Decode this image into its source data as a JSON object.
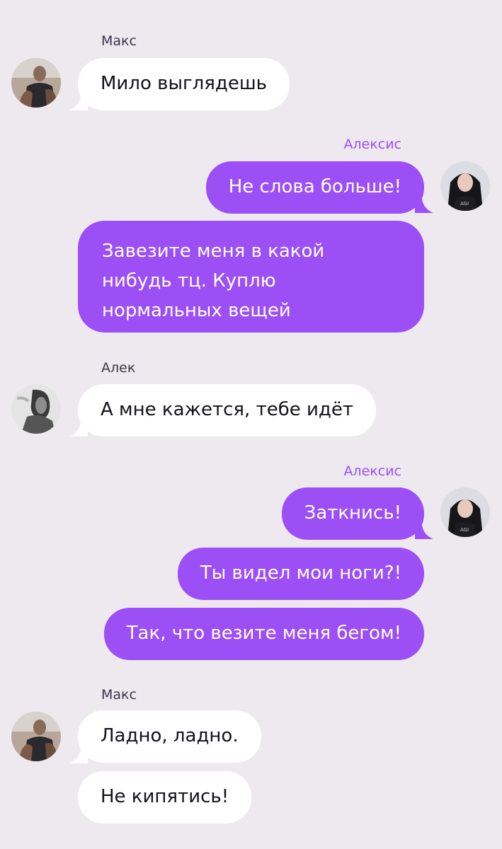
{
  "colors": {
    "background": "#eee9ef",
    "incoming_bubble": "#ffffff",
    "outgoing_bubble": "#9b4ff5",
    "outgoing_name": "#9b4ff5",
    "incoming_name": "#3b3646"
  },
  "messages": [
    {
      "sender": "Макс",
      "side": "left",
      "texts": [
        "Мило выглядешь"
      ]
    },
    {
      "sender": "Алексис",
      "side": "right",
      "texts": [
        "Не слова больше!",
        "Завезите меня в какой нибудь тц. Куплю нормальных вещей"
      ]
    },
    {
      "sender": "Алек",
      "side": "left",
      "texts": [
        "А мне кажется, тебе идёт"
      ]
    },
    {
      "sender": "Алексис",
      "side": "right",
      "texts": [
        "Заткнись!",
        "Ты видел мои ноги?!",
        "Так, что везите меня бегом!"
      ]
    },
    {
      "sender": "Макс",
      "side": "left",
      "texts": [
        "Ладно, ладно.",
        "Не кипятись!"
      ]
    }
  ]
}
